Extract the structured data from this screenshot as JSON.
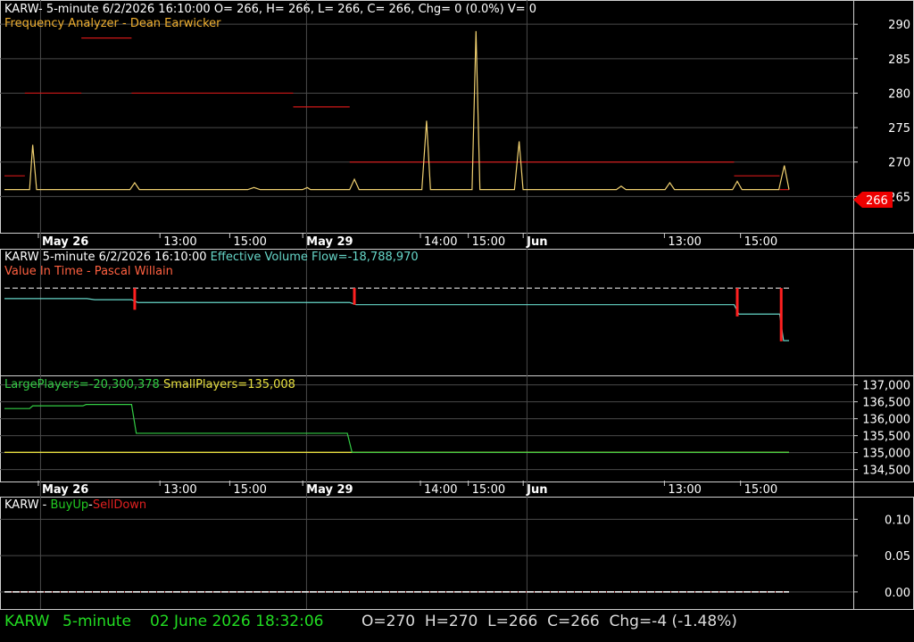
{
  "colors": {
    "background": "#000000",
    "frame": "#cfcfcf",
    "grid": "#4a4a4a",
    "price": "#f0d070",
    "frequency": "#d01818",
    "value_in_time_red": "#ff2020",
    "effective_flow": "#66d6c8",
    "large_players": "#33cc44",
    "small_players": "#e8e040",
    "buy_up": "#22cc22",
    "sell_down": "#e02020",
    "status_green": "#22dd22",
    "status_white": "#dddddd",
    "price_tag": "#ee0000"
  },
  "panel1": {
    "header": "KARW- 5-minute 6/2/2026 16:10:00 O= 266, H= 266, L= 266, C= 266, Chg= 0 (0.0%) V= 0",
    "subtitle": "Frequency Analyzer - Dean Earwicker",
    "price_tag": "266"
  },
  "panel2": {
    "header": "KARW 5-minute  6/2/2026 16:10:00",
    "effective_label": "Effective Volume Flow=-18,788,970",
    "subtitle": "Value In Time - Pascal Willain"
  },
  "panel3": {
    "large_label": "LargePlayers=-20,300,378",
    "small_label": "SmallPlayers=135,008"
  },
  "panel4": {
    "prefix": "KARW - ",
    "buy_label": "BuyUp",
    "dash": "-",
    "sell_label": "SellDown"
  },
  "status": {
    "symbol": "KARW",
    "interval": "5-minute",
    "datetime": "02 June 2026 18:32:06",
    "ohlc": "O=270  H=270  L=266  C=266  Chg=-4 (-1.48%)"
  },
  "time_axis": {
    "labels": [
      {
        "text": "May 26",
        "bold": true
      },
      {
        "text": "13:00",
        "bold": false
      },
      {
        "text": "15:00",
        "bold": false
      },
      {
        "text": "May 29",
        "bold": true
      },
      {
        "text": "14:00",
        "bold": false
      },
      {
        "text": "15:00",
        "bold": false
      },
      {
        "text": "Jun",
        "bold": true
      },
      {
        "text": "13:00",
        "bold": false
      },
      {
        "text": "15:00",
        "bold": false
      }
    ]
  },
  "chart_data": [
    {
      "type": "line",
      "title": "Frequency Analyzer - Dean Earwicker",
      "ylim": [
        260,
        293
      ],
      "yticks": [
        265,
        270,
        275,
        280,
        285,
        290
      ],
      "x_range": [
        0,
        1
      ],
      "series": [
        {
          "kind": "price",
          "points": [
            [
              0.0,
              266
            ],
            [
              0.032,
              266
            ],
            [
              0.036,
              272.5
            ],
            [
              0.041,
              266
            ],
            [
              0.16,
              266
            ],
            [
              0.166,
              267
            ],
            [
              0.172,
              266
            ],
            [
              0.31,
              266
            ],
            [
              0.318,
              266.3
            ],
            [
              0.326,
              266
            ],
            [
              0.38,
              266
            ],
            [
              0.386,
              266.3
            ],
            [
              0.39,
              266
            ],
            [
              0.44,
              266
            ],
            [
              0.446,
              267.5
            ],
            [
              0.452,
              266
            ],
            [
              0.532,
              266
            ],
            [
              0.538,
              276
            ],
            [
              0.543,
              266
            ],
            [
              0.596,
              266
            ],
            [
              0.601,
              289
            ],
            [
              0.606,
              266
            ],
            [
              0.65,
              266
            ],
            [
              0.656,
              273
            ],
            [
              0.661,
              266
            ],
            [
              0.78,
              266
            ],
            [
              0.786,
              266.5
            ],
            [
              0.792,
              266
            ],
            [
              0.842,
              266
            ],
            [
              0.848,
              267
            ],
            [
              0.854,
              266
            ],
            [
              0.928,
              266
            ],
            [
              0.934,
              267.2
            ],
            [
              0.94,
              266
            ],
            [
              0.987,
              266
            ],
            [
              0.994,
              269.5
            ],
            [
              1.0,
              266
            ]
          ]
        },
        {
          "kind": "frequency_levels",
          "segments": [
            [
              0.0,
              0.026,
              268
            ],
            [
              0.026,
              0.098,
              280
            ],
            [
              0.098,
              0.162,
              288
            ],
            [
              0.162,
              0.368,
              280
            ],
            [
              0.368,
              0.44,
              278
            ],
            [
              0.44,
              0.93,
              270
            ],
            [
              0.93,
              0.988,
              268
            ],
            [
              0.988,
              1.0,
              266
            ]
          ]
        }
      ]
    },
    {
      "type": "line",
      "title": "Value In Time - Pascal Willain",
      "ylim": [
        0,
        1
      ],
      "series": [
        {
          "name": "Effective Volume Flow",
          "points": [
            [
              0.0,
              0.24
            ],
            [
              0.105,
              0.24
            ],
            [
              0.115,
              0.26
            ],
            [
              0.162,
              0.26
            ],
            [
              0.17,
              0.31
            ],
            [
              0.44,
              0.31
            ],
            [
              0.448,
              0.35
            ],
            [
              0.93,
              0.35
            ],
            [
              0.936,
              0.52
            ],
            [
              0.988,
              0.52
            ],
            [
              0.993,
              1.0
            ],
            [
              1.0,
              1.0
            ]
          ]
        },
        {
          "kind": "value_in_time",
          "points": [
            [
              0.0,
              0.22
            ],
            [
              1.0,
              0.22
            ]
          ]
        }
      ],
      "spikes": [
        [
          0.166,
          0.22,
          0.41
        ],
        [
          0.446,
          0.22,
          0.32
        ],
        [
          0.934,
          0.22,
          0.53
        ],
        [
          0.99,
          0.22,
          0.98
        ]
      ]
    },
    {
      "type": "line",
      "ylim": [
        134200,
        137200
      ],
      "yticks": [
        134500,
        135000,
        135500,
        136000,
        136500,
        137000
      ],
      "series": [
        {
          "name": "LargePlayers",
          "points": [
            [
              0.0,
              136300
            ],
            [
              0.032,
              136300
            ],
            [
              0.036,
              136380
            ],
            [
              0.1,
              136380
            ],
            [
              0.104,
              136420
            ],
            [
              0.162,
              136420
            ],
            [
              0.168,
              135570
            ],
            [
              0.437,
              135570
            ],
            [
              0.443,
              135008
            ],
            [
              1.0,
              135008
            ]
          ]
        },
        {
          "name": "SmallPlayers",
          "points": [
            [
              0.0,
              135008
            ],
            [
              1.0,
              135008
            ]
          ]
        }
      ]
    },
    {
      "type": "line",
      "ylim": [
        -0.01,
        0.125
      ],
      "yticks": [
        0.0,
        0.05,
        0.1
      ],
      "series": [
        {
          "name": "BuyUp",
          "points": [
            [
              0.0,
              0.0
            ],
            [
              1.0,
              0.0
            ]
          ]
        },
        {
          "name": "SellDown",
          "points": [
            [
              0.0,
              0.0
            ],
            [
              1.0,
              0.0
            ]
          ]
        }
      ]
    }
  ]
}
